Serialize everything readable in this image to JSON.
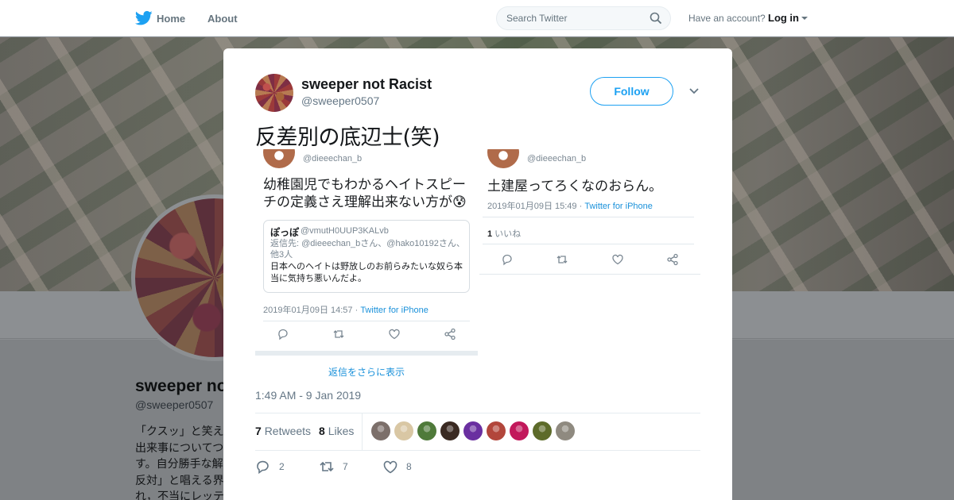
{
  "nav": {
    "home_label": "Home",
    "about_label": "About",
    "search_placeholder": "Search Twitter",
    "have_account": "Have an account?",
    "login_label": "Log in"
  },
  "profile": {
    "name": "sweeper no",
    "handle": "@sweeper0507",
    "bio": "「クスッ」と笑え出来事についてつす。自分勝手な解反対」と唱える界れ，不当にレッテ"
  },
  "tweet": {
    "author_name": "sweeper not Racist",
    "author_handle": "@sweeper0507",
    "follow_label": "Follow",
    "text": "反差別の底辺士(笑)",
    "timestamp": "1:49 AM - 9 Jan 2019",
    "retweets_count": "7",
    "retweets_label": "Retweets",
    "likes_count": "8",
    "likes_label": "Likes",
    "replies_action": "2",
    "retweets_action": "7",
    "likes_action": "8"
  },
  "embedded_left": {
    "handle": "@dieeechan_b",
    "text": "幼稚園児でもわかるヘイトスピーチの定義さえ理解出来ない方が😰",
    "quote_name": "ぽっぽ",
    "quote_handle": "@vmutH0UUP3KALvb",
    "quote_reply": "返信先: @dieeechan_bさん、@hako10192さん、他3人",
    "quote_body": "日本へのヘイトは野放しのお前らみたいな奴ら本当に気持ち悪いんだよ。",
    "date": "2019年01月09日 14:57 · ",
    "via": "Twitter for iPhone",
    "more_replies": "返信をさらに表示"
  },
  "embedded_right": {
    "handle": "@dieeechan_b",
    "text": "土建屋ってろくなのおらん。",
    "date": "2019年01月09日 15:49 · ",
    "via": "Twitter for iPhone",
    "likes_count": "1",
    "likes_label": " いいね"
  },
  "colors": {
    "brand_blue": "#1da1f2",
    "text_primary": "#14171a",
    "text_secondary": "#657786"
  },
  "likers": [
    "#7c6f6a",
    "#d9c7a4",
    "#4f7a3a",
    "#3a2a22",
    "#6a2fa0",
    "#b2463b",
    "#c2185b",
    "#5d6b2a",
    "#8f8a80"
  ]
}
